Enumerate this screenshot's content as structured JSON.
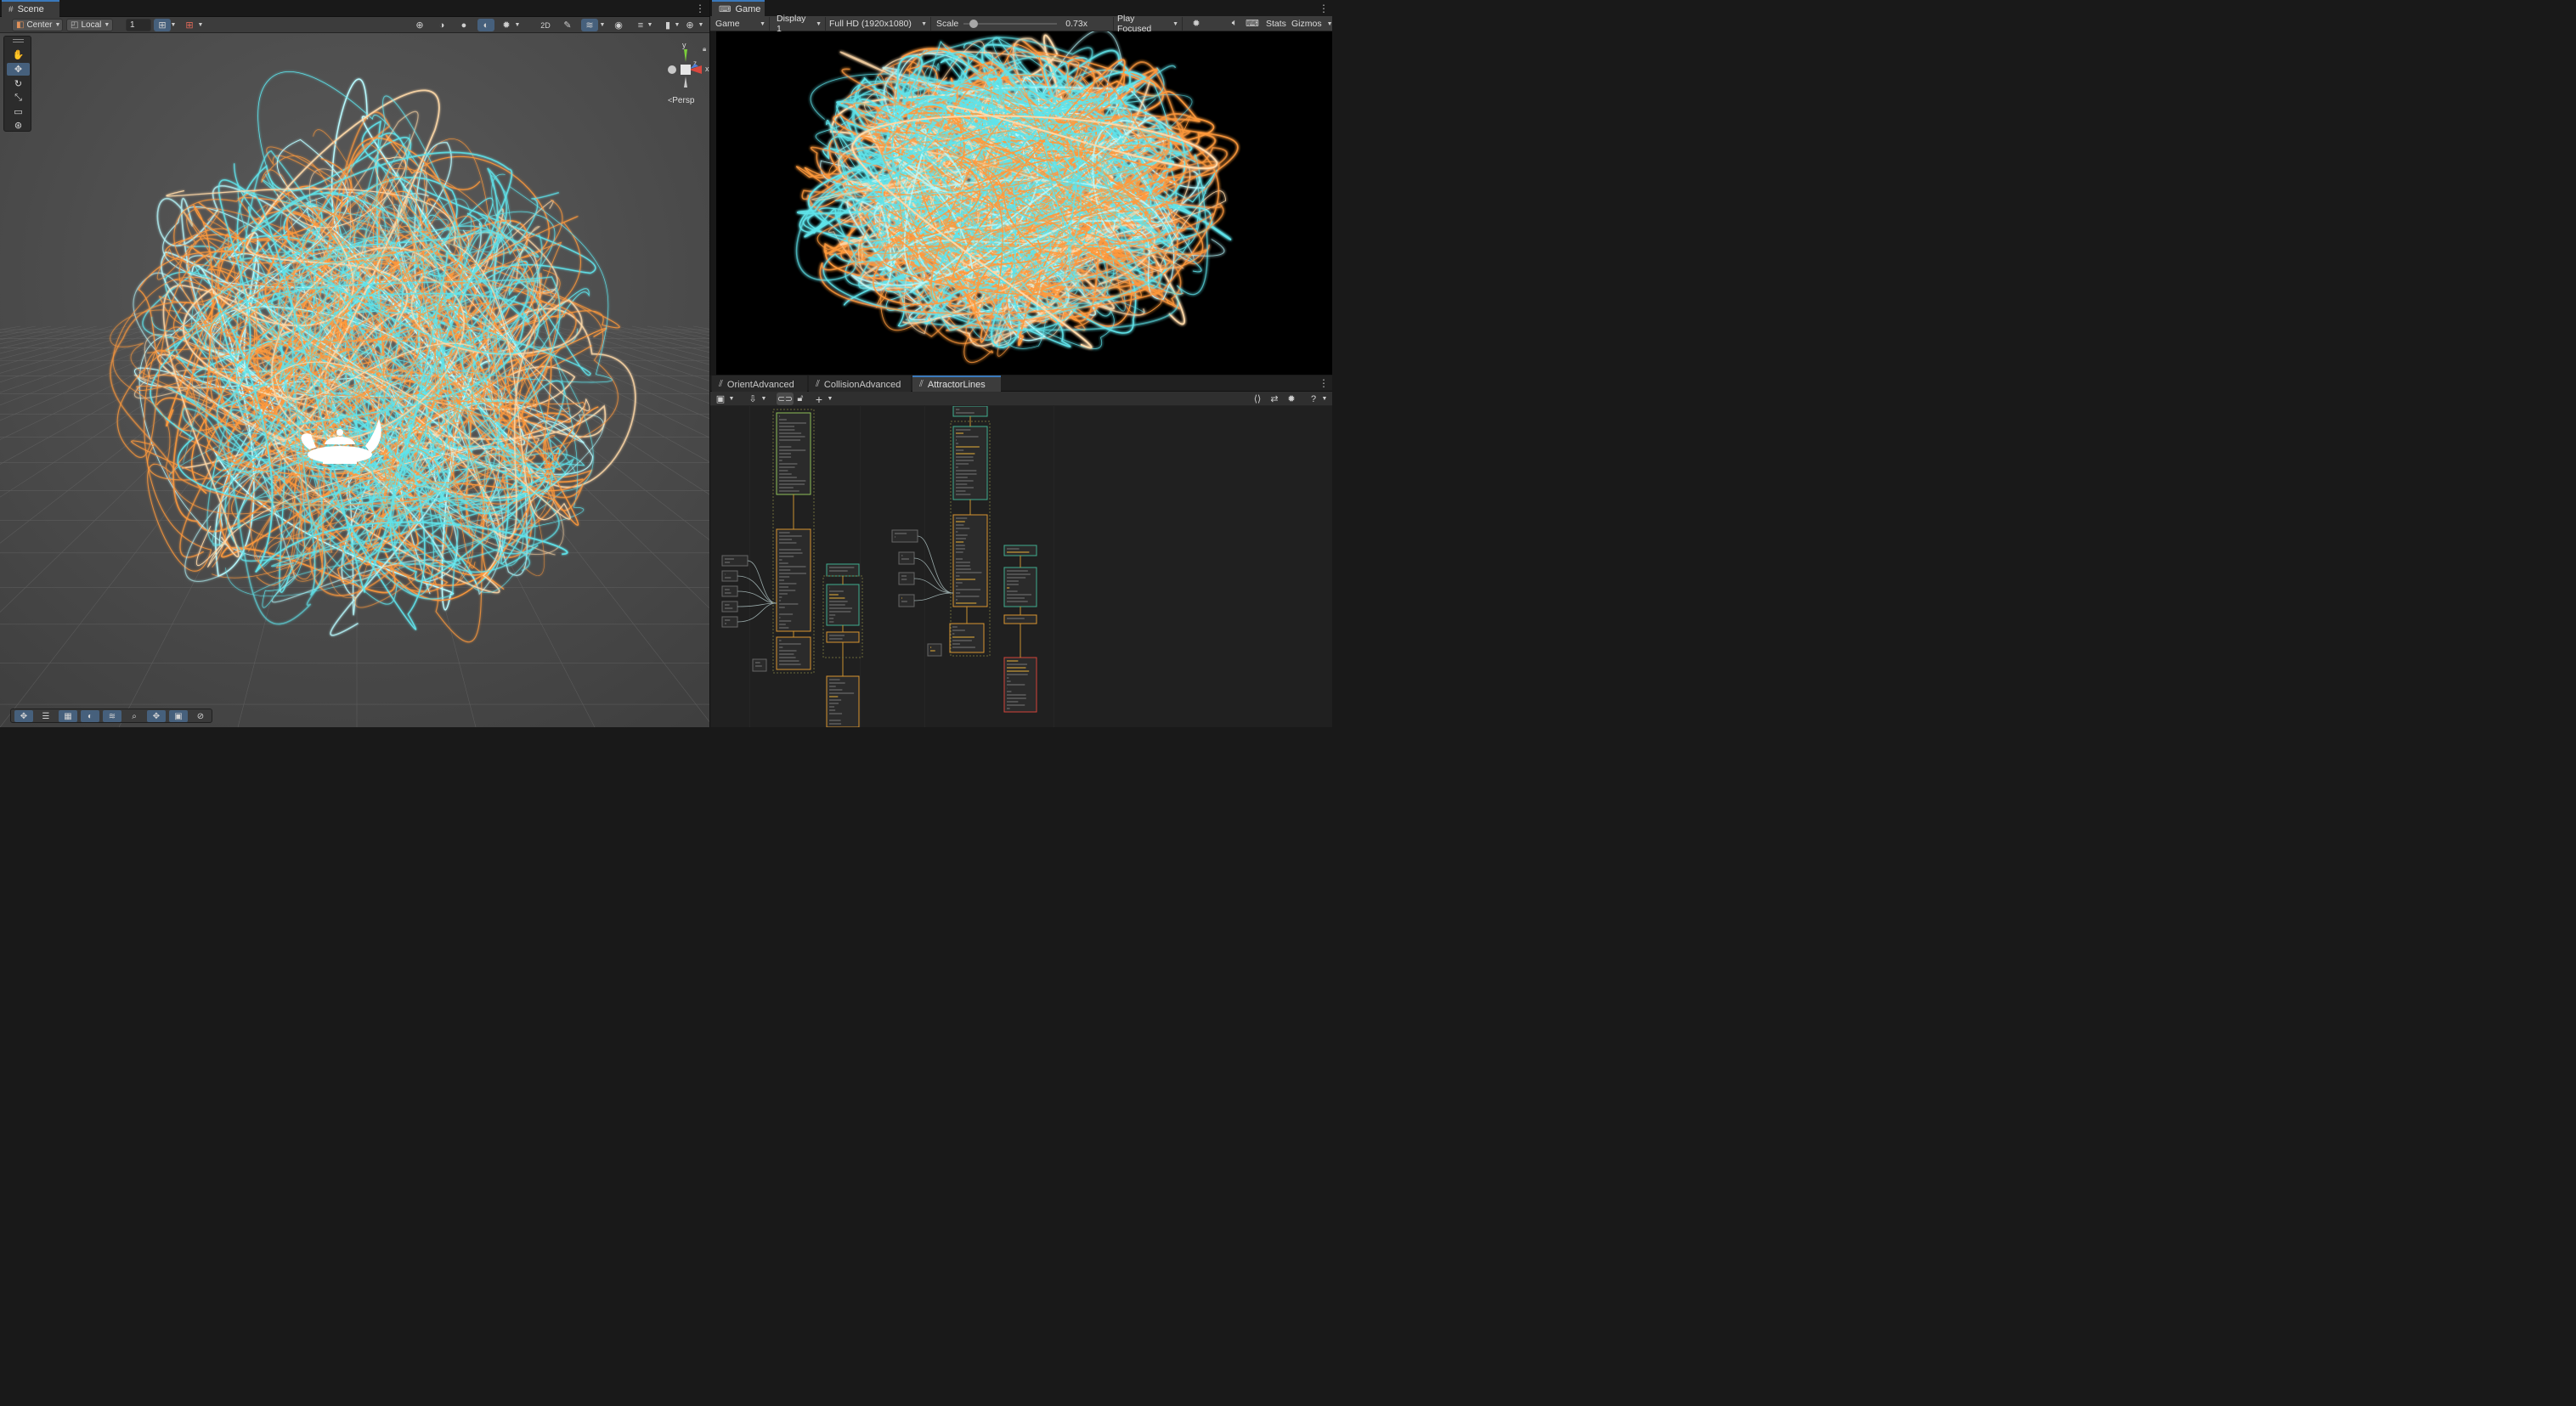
{
  "scene": {
    "tab_label": "Scene",
    "pivot_mode": "Center",
    "pivot_rotation": "Local",
    "grid_snap_value": "1",
    "view_label": "Persp",
    "gizmo_axes": {
      "y": "y",
      "x": "x",
      "z": "z"
    }
  },
  "game": {
    "tab_label": "Game",
    "mode": "Game",
    "display": "Display 1",
    "resolution": "Full HD (1920x1080)",
    "scale_label": "Scale",
    "scale_value": "0.73x",
    "scale_fraction": 0.07,
    "play_mode": "Play Focused",
    "stats_label": "Stats",
    "gizmos_label": "Gizmos"
  },
  "vfx": {
    "tabs": [
      "OrientAdvanced",
      "CollisionAdvanced",
      "AttractorLines"
    ],
    "active_tab": "AttractorLines"
  },
  "colors": {
    "accent_blue": "#3a79bb",
    "active_button": "#46607c",
    "particle_orange": "#ff9a3c",
    "particle_cyan": "#5fe3ea",
    "gizmo_x": "#d9473e",
    "gizmo_y": "#7ccf3a",
    "gizmo_z": "#4f7fd8"
  },
  "icons": {
    "scene_tab": "hash-icon",
    "game_tab": "gamepad-icon",
    "vfx_tab": "vfx-graph-icon",
    "tools": [
      "hand-icon",
      "move-icon",
      "rotate-icon",
      "scale-icon",
      "rect-icon",
      "transform-icon"
    ]
  }
}
